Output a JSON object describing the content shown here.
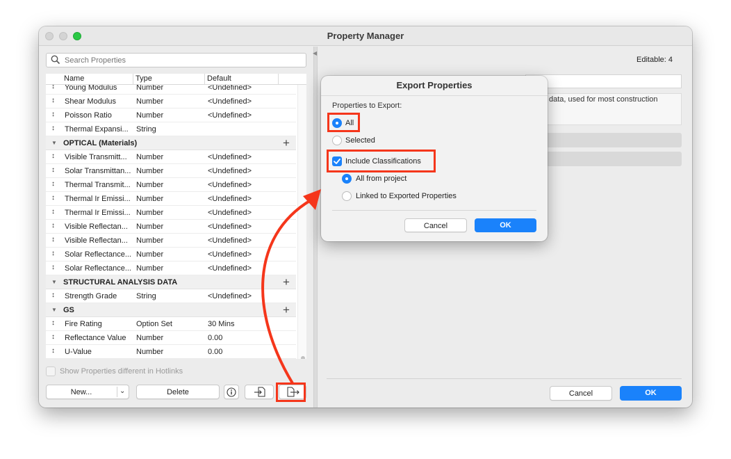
{
  "window": {
    "title": "Property Manager"
  },
  "search": {
    "placeholder": "Search Properties"
  },
  "table": {
    "columns": [
      "Name",
      "Type",
      "Default"
    ],
    "rows": [
      {
        "kind": "item",
        "name": "Young Modulus",
        "type": "Number",
        "default": "<Undefined>"
      },
      {
        "kind": "item",
        "name": "Shear Modulus",
        "type": "Number",
        "default": "<Undefined>"
      },
      {
        "kind": "item",
        "name": "Poisson Ratio",
        "type": "Number",
        "default": "<Undefined>"
      },
      {
        "kind": "item",
        "name": "Thermal Expansi...",
        "type": "String",
        "default": ""
      },
      {
        "kind": "group",
        "name": "OPTICAL (Materials)"
      },
      {
        "kind": "item",
        "name": "Visible Transmitt...",
        "type": "Number",
        "default": "<Undefined>"
      },
      {
        "kind": "item",
        "name": "Solar Transmittan...",
        "type": "Number",
        "default": "<Undefined>"
      },
      {
        "kind": "item",
        "name": "Thermal Transmit...",
        "type": "Number",
        "default": "<Undefined>"
      },
      {
        "kind": "item",
        "name": "Thermal Ir Emissi...",
        "type": "Number",
        "default": "<Undefined>"
      },
      {
        "kind": "item",
        "name": "Thermal Ir Emissi...",
        "type": "Number",
        "default": "<Undefined>"
      },
      {
        "kind": "item",
        "name": "Visible Reflectan...",
        "type": "Number",
        "default": "<Undefined>"
      },
      {
        "kind": "item",
        "name": "Visible Reflectan...",
        "type": "Number",
        "default": "<Undefined>"
      },
      {
        "kind": "item",
        "name": "Solar Reflectance...",
        "type": "Number",
        "default": "<Undefined>"
      },
      {
        "kind": "item",
        "name": "Solar Reflectance...",
        "type": "Number",
        "default": "<Undefined>"
      },
      {
        "kind": "group",
        "name": "STRUCTURAL ANALYSIS DATA"
      },
      {
        "kind": "item",
        "name": "Strength Grade",
        "type": "String",
        "default": "<Undefined>"
      },
      {
        "kind": "group",
        "name": "GS"
      },
      {
        "kind": "item",
        "name": "Fire Rating",
        "type": "Option Set",
        "default": "30 Mins"
      },
      {
        "kind": "item",
        "name": "Reflectance Value",
        "type": "Number",
        "default": "0.00"
      },
      {
        "kind": "item",
        "name": "U-Value",
        "type": "Number",
        "default": "0.00"
      }
    ]
  },
  "hotlinks": {
    "label": "Show Properties different in Hotlinks"
  },
  "toolbar": {
    "new_label": "New...",
    "delete_label": "Delete"
  },
  "right_panel": {
    "editable_label": "Editable: 4",
    "description_text": "data, used for most construction",
    "cancel_label": "Cancel",
    "ok_label": "OK"
  },
  "dialog": {
    "title": "Export Properties",
    "section_label": "Properties to Export:",
    "option_all": "All",
    "option_selected": "Selected",
    "include_classifications": "Include Classifications",
    "option_all_from_project": "All from project",
    "option_linked": "Linked to Exported Properties",
    "cancel_label": "Cancel",
    "ok_label": "OK"
  },
  "colors": {
    "accent": "#1a82fb",
    "highlight": "#f5361b"
  }
}
